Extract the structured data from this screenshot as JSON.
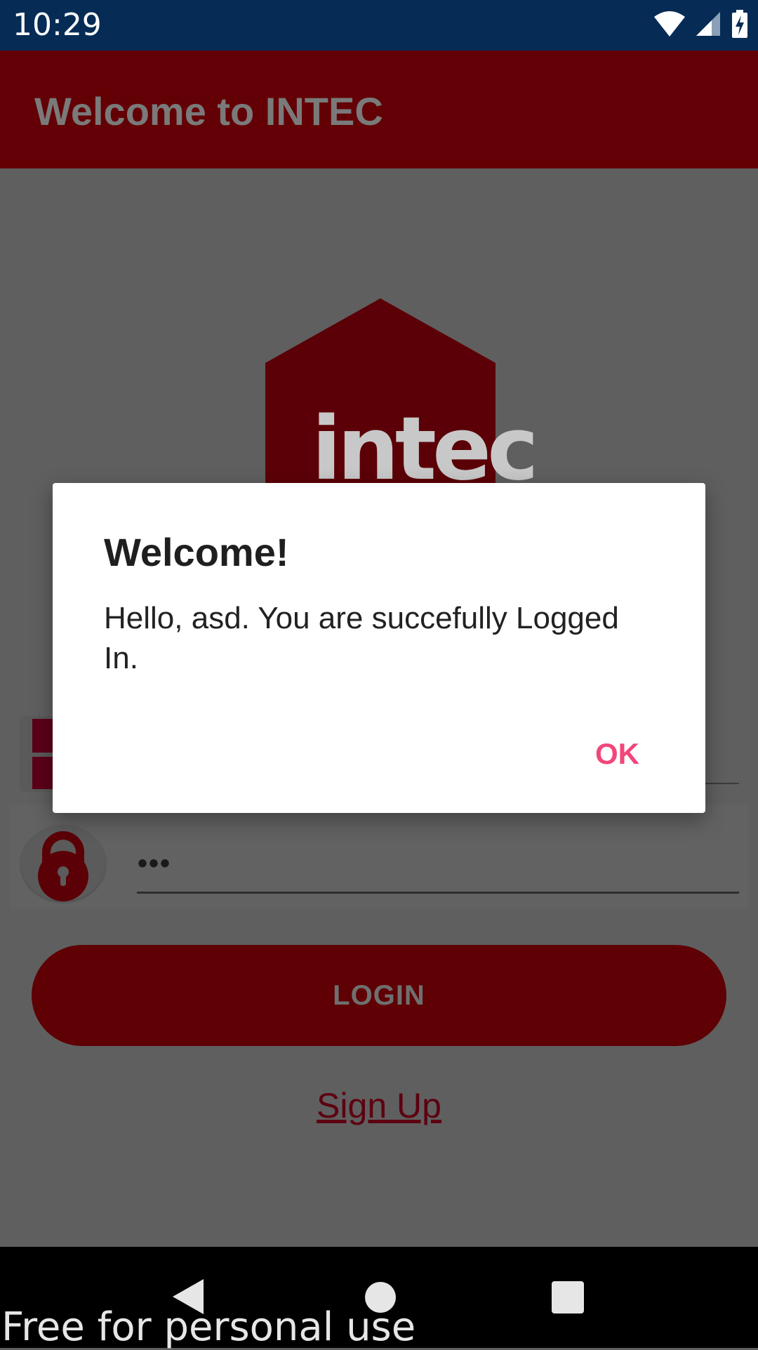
{
  "status_bar": {
    "time": "10:29"
  },
  "app_bar": {
    "title": "Welcome to INTEC"
  },
  "logo": {
    "text": "intec"
  },
  "login_form": {
    "password_value": "•••",
    "login_label": "LOGIN",
    "signup_label": "Sign Up"
  },
  "dialog": {
    "title": "Welcome!",
    "message": "Hello, asd. You are succefully Logged In.",
    "ok_label": "OK"
  },
  "watermark": "Free for personal use",
  "colors": {
    "status_bar": "#062c55",
    "app_bar": "#630005",
    "accent": "#f2467a",
    "scrim_background": "#5f5f5f"
  }
}
